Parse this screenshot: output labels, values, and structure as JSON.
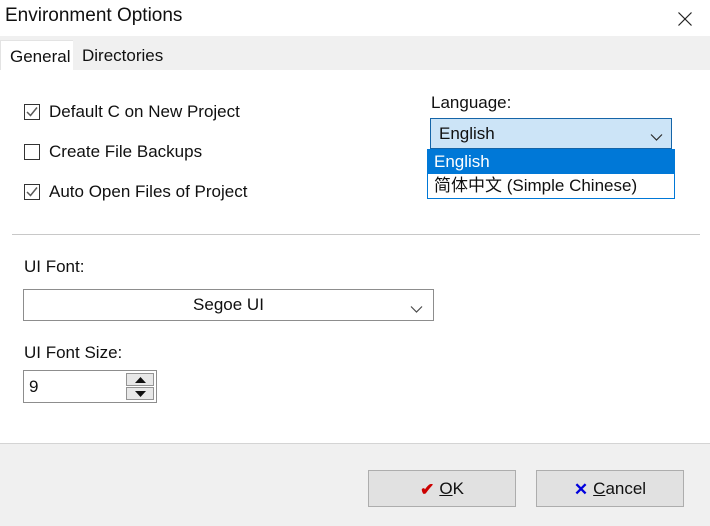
{
  "window": {
    "title": "Environment Options",
    "close_icon": "close-icon"
  },
  "tabs": [
    {
      "label": "General",
      "active": true
    },
    {
      "label": "Directories",
      "active": false
    }
  ],
  "general": {
    "checkboxes": [
      {
        "label": "Default C on New Project",
        "checked": true
      },
      {
        "label": "Create File Backups",
        "checked": false
      },
      {
        "label": "Auto Open Files of Project",
        "checked": true
      }
    ],
    "language": {
      "label": "Language:",
      "value": "English",
      "expanded": true,
      "arrow_icon": "chevron-down-icon",
      "options": [
        {
          "label": "English",
          "selected": true
        },
        {
          "label": "简体中文 (Simple Chinese)",
          "selected": false
        }
      ]
    },
    "ui_font": {
      "label": "UI Font:",
      "value": "Segoe UI",
      "arrow_icon": "chevron-down-icon"
    },
    "ui_font_size": {
      "label": "UI Font Size:",
      "value": "9",
      "up_icon": "triangle-up-icon",
      "down_icon": "triangle-down-icon"
    }
  },
  "footer": {
    "ok": {
      "glyph": "✔",
      "text_before": "",
      "accel": "O",
      "text_after": "K",
      "icon": "check-icon"
    },
    "cancel": {
      "glyph": "✕",
      "text_before": "",
      "accel": "C",
      "text_after": "ancel",
      "icon": "cross-icon"
    }
  },
  "colors": {
    "accent_blue": "#0078d7",
    "combo_fill": "#cce4f7",
    "ok_glyph": "#cc0000",
    "cancel_glyph": "#0000dd",
    "chrome_gray": "#f0f0f0"
  }
}
